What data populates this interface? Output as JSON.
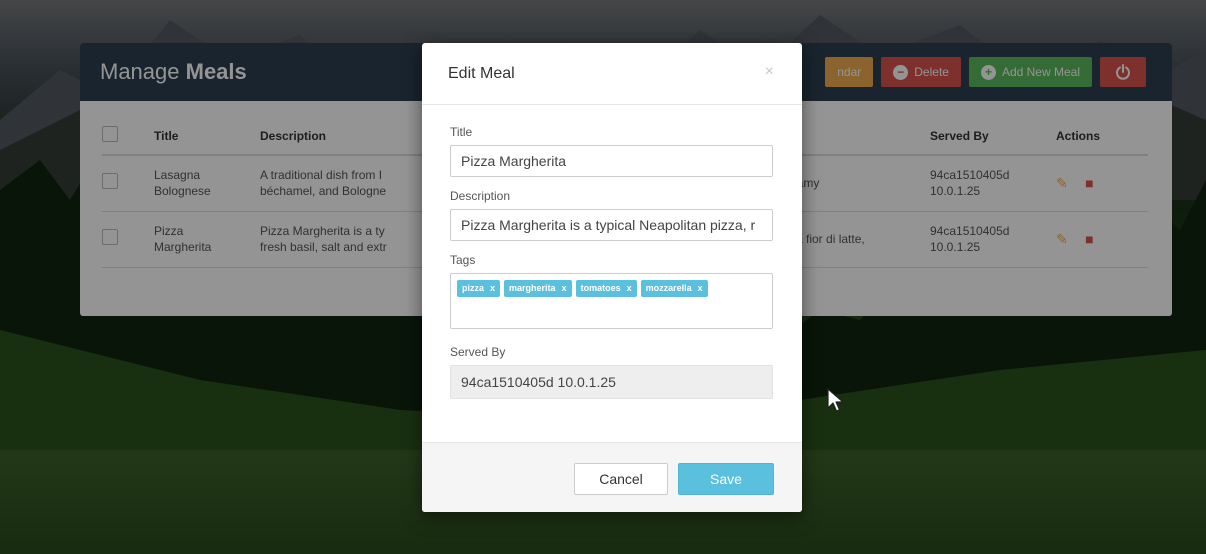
{
  "colors": {
    "panel_header": "#2c3e50",
    "calendar": "#f0ad4e",
    "danger": "#d9534f",
    "success": "#5cb85c",
    "info": "#5bc0de"
  },
  "panel": {
    "title_normal": "Manage ",
    "title_bold": "Meals",
    "buttons": {
      "calendar_label": "ndar",
      "delete_label": "Delete",
      "add_label": "Add New Meal"
    },
    "icons": {
      "delete": "minus-circle-icon",
      "add": "plus-circle-icon",
      "power": "power-icon"
    },
    "columns": {
      "title": "Title",
      "description": "Description",
      "served_by": "Served By",
      "actions": "Actions"
    },
    "rows": [
      {
        "title_line1": "Lasagna",
        "title_line2": "Bolognese",
        "desc_line1": "A traditional dish from I",
        "desc_line2": "béchamel, and Bologne",
        "ingredients_visible": "creamy",
        "served_line1": "94ca1510405d",
        "served_line2": "10.0.1.25"
      },
      {
        "title_line1": "Pizza",
        "title_line2": "Margherita",
        "desc_line1": "Pizza Margherita is a ty",
        "desc_line2": "fresh basil, salt and extr",
        "ingredients_visible": "rella fior di latte,",
        "served_line1": "94ca1510405d",
        "served_line2": "10.0.1.25"
      }
    ]
  },
  "modal": {
    "title": "Edit Meal",
    "close_glyph": "×",
    "labels": {
      "title": "Title",
      "description": "Description",
      "tags": "Tags",
      "served_by": "Served By"
    },
    "values": {
      "title": "Pizza Margherita",
      "description": "Pizza Margherita is a typical Neapolitan pizza, r",
      "served_by": "94ca1510405d 10.0.1.25"
    },
    "tags": [
      "pizza",
      "margherita",
      "tomatoes",
      "mozzarella"
    ],
    "tag_remove": "x",
    "buttons": {
      "cancel": "Cancel",
      "save": "Save"
    }
  }
}
